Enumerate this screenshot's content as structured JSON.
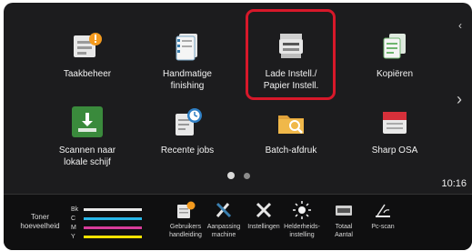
{
  "tiles": {
    "taakbeheer": "Taakbeheer",
    "handmatige": "Handmatige\nfinishing",
    "lade": "Lade Instell./\nPapier Instell.",
    "kopieren": "Kopiëren",
    "scannen": "Scannen naar\nlokale schijf",
    "recente": "Recente jobs",
    "batch": "Batch-afdruk",
    "sharposa": "Sharp OSA"
  },
  "clock": "10:16",
  "toner": {
    "label": "Toner\nhoeveelheid",
    "rows": [
      {
        "key": "Bk",
        "color": "#e8e8e8"
      },
      {
        "key": "C",
        "color": "#29b6e8"
      },
      {
        "key": "M",
        "color": "#d83c9a"
      },
      {
        "key": "Y",
        "color": "#f2e200"
      }
    ]
  },
  "dock": {
    "handleiding": "Gebruikers\nhandleiding",
    "aanpassing": "Aanpassing\nmachine",
    "instellingen": "Instellingen",
    "helderheid": "Helderheids-\ninstelling",
    "totaal": "Totaal\nAantal",
    "pcscan": "Pc-scan"
  },
  "colors": {
    "highlight": "#d7182a",
    "panel": "#1c1c1e",
    "dock": "#0f0f10"
  },
  "icons": {
    "taakbeheer": "job-status-icon",
    "handmatige": "finishing-icon",
    "lade": "tray-settings-icon",
    "kopieren": "copy-icon",
    "scannen": "scan-to-disk-icon",
    "recente": "recent-jobs-icon",
    "batch": "batch-print-icon",
    "sharposa": "sharp-osa-icon"
  }
}
